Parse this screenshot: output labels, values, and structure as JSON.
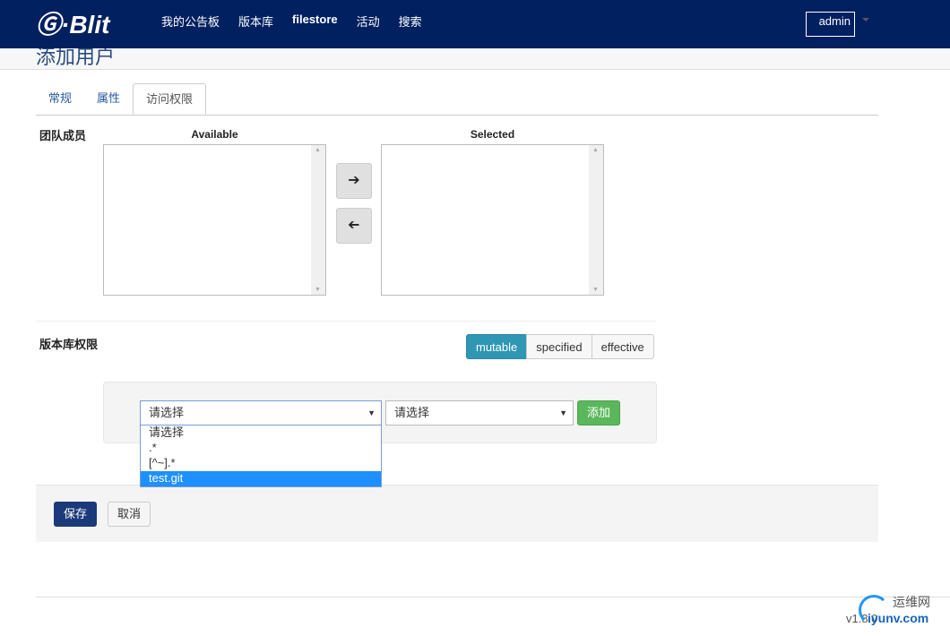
{
  "nav": {
    "logo": "GitBlit",
    "links": [
      "我的公告板",
      "版本库",
      "filestore",
      "活动",
      "搜索"
    ],
    "user": "admin"
  },
  "page": {
    "title": "添加用户"
  },
  "tabs": [
    "常规",
    "属性",
    "访问权限"
  ],
  "team": {
    "label": "团队成员",
    "available": "Available",
    "selected": "Selected",
    "add_icon": "arrow-right-icon",
    "remove_icon": "arrow-left-icon"
  },
  "repo": {
    "label": "版本库权限",
    "modes": [
      "mutable",
      "specified",
      "effective"
    ],
    "select1": "请选择",
    "select2": "请选择",
    "add": "添加",
    "options": [
      "请选择",
      ".*",
      "[^~].*",
      "test.git"
    ]
  },
  "footer": {
    "save": "保存",
    "cancel": "取消"
  },
  "version": "v1.8.0",
  "watermark": {
    "cn": "运维网",
    "url": "iyunv.com"
  }
}
